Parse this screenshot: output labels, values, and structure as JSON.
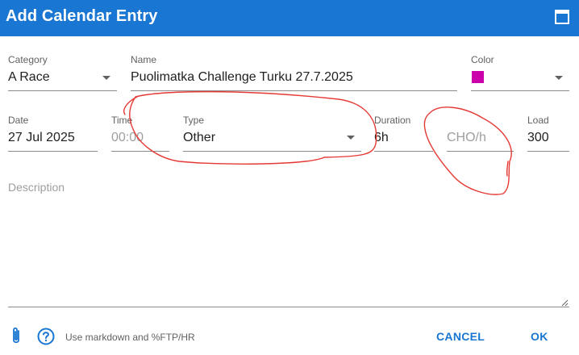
{
  "dialog": {
    "title": "Add Calendar Entry"
  },
  "fields": {
    "category": {
      "label": "Category",
      "value": "A Race"
    },
    "name": {
      "label": "Name",
      "value": "Puolimatka Challenge Turku 27.7.2025"
    },
    "color": {
      "label": "Color",
      "value": "#cc00aa"
    },
    "date": {
      "label": "Date",
      "value": "27 Jul 2025"
    },
    "time": {
      "label": "Time",
      "placeholder": "00:00"
    },
    "type": {
      "label": "Type",
      "value": "Other"
    },
    "duration": {
      "label": "Duration",
      "value": "6h"
    },
    "cho": {
      "placeholder": "CHO/h"
    },
    "load": {
      "label": "Load",
      "value": "300"
    },
    "description": {
      "placeholder": "Description"
    }
  },
  "footer": {
    "icons": [
      "paperclip-icon",
      "help-circle-icon"
    ],
    "hint": "Use markdown and %FTP/HR",
    "cancel_label": "CANCEL",
    "ok_label": "OK"
  },
  "colors": {
    "header": "#1976d2",
    "accent": "#1976d2",
    "annotation": "#e53935"
  }
}
